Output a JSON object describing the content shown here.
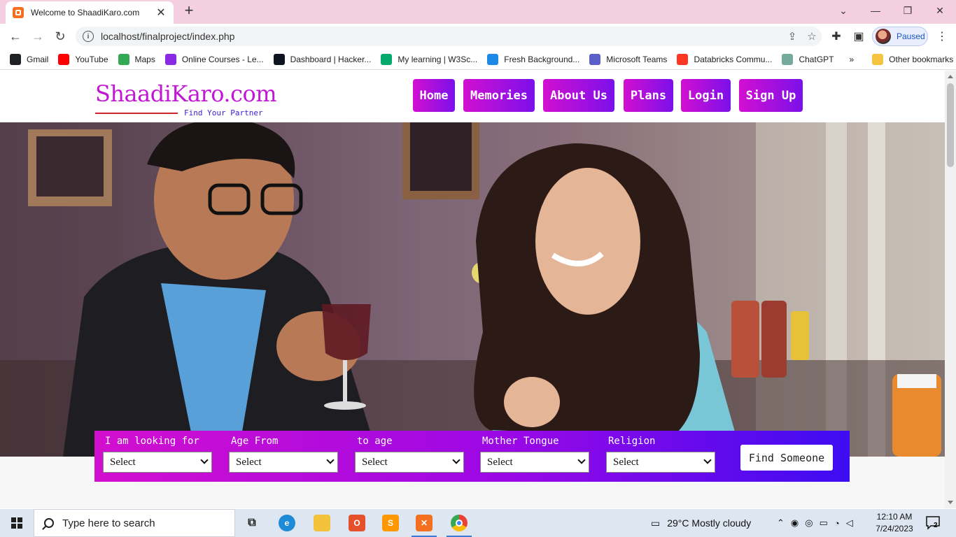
{
  "browser": {
    "tab_title": "Welcome to ShaadiKaro.com",
    "url": "localhost/finalproject/index.php",
    "profile_label": "Paused",
    "bookmarks": [
      {
        "label": "Gmail",
        "icon": "gmail-icon",
        "color": "#202124"
      },
      {
        "label": "YouTube",
        "icon": "youtube-icon",
        "color": "#ff0000"
      },
      {
        "label": "Maps",
        "icon": "maps-icon",
        "color": "#34a853"
      },
      {
        "label": "Online Courses - Le...",
        "icon": "courses-icon",
        "color": "#8a2be2"
      },
      {
        "label": "Dashboard | Hacker...",
        "icon": "hackerrank-icon",
        "color": "#0e141e"
      },
      {
        "label": "My learning | W3Sc...",
        "icon": "w3schools-icon",
        "color": "#04aa6d"
      },
      {
        "label": "Fresh Background...",
        "icon": "background-icon",
        "color": "#1e88e5"
      },
      {
        "label": "Microsoft Teams",
        "icon": "teams-icon",
        "color": "#5b5fc7"
      },
      {
        "label": "Databricks Commu...",
        "icon": "databricks-icon",
        "color": "#ff3621"
      },
      {
        "label": "ChatGPT",
        "icon": "chatgpt-icon",
        "color": "#74aa9c"
      }
    ],
    "other_bookmarks": "Other bookmarks"
  },
  "site": {
    "logo": "ShaadiKaro.com",
    "tagline": "Find Your Partner",
    "nav": [
      "Home",
      "Memories",
      "About Us",
      "Plans",
      "Login",
      "Sign Up"
    ],
    "search": {
      "fields": [
        {
          "label": "I am looking for",
          "value": "Select"
        },
        {
          "label": "Age From",
          "value": "Select"
        },
        {
          "label": "to age",
          "value": "Select"
        },
        {
          "label": "Mother Tongue",
          "value": "Select"
        },
        {
          "label": "Religion",
          "value": "Select"
        }
      ],
      "button": "Find Someone"
    },
    "brand_colors": {
      "primary": "#c216d6",
      "secondary": "#3d0cf2"
    }
  },
  "taskbar": {
    "search_placeholder": "Type here to search",
    "weather": "29°C  Mostly cloudy",
    "time": "12:10 AM",
    "date": "7/24/2023",
    "notification_count": "2"
  }
}
